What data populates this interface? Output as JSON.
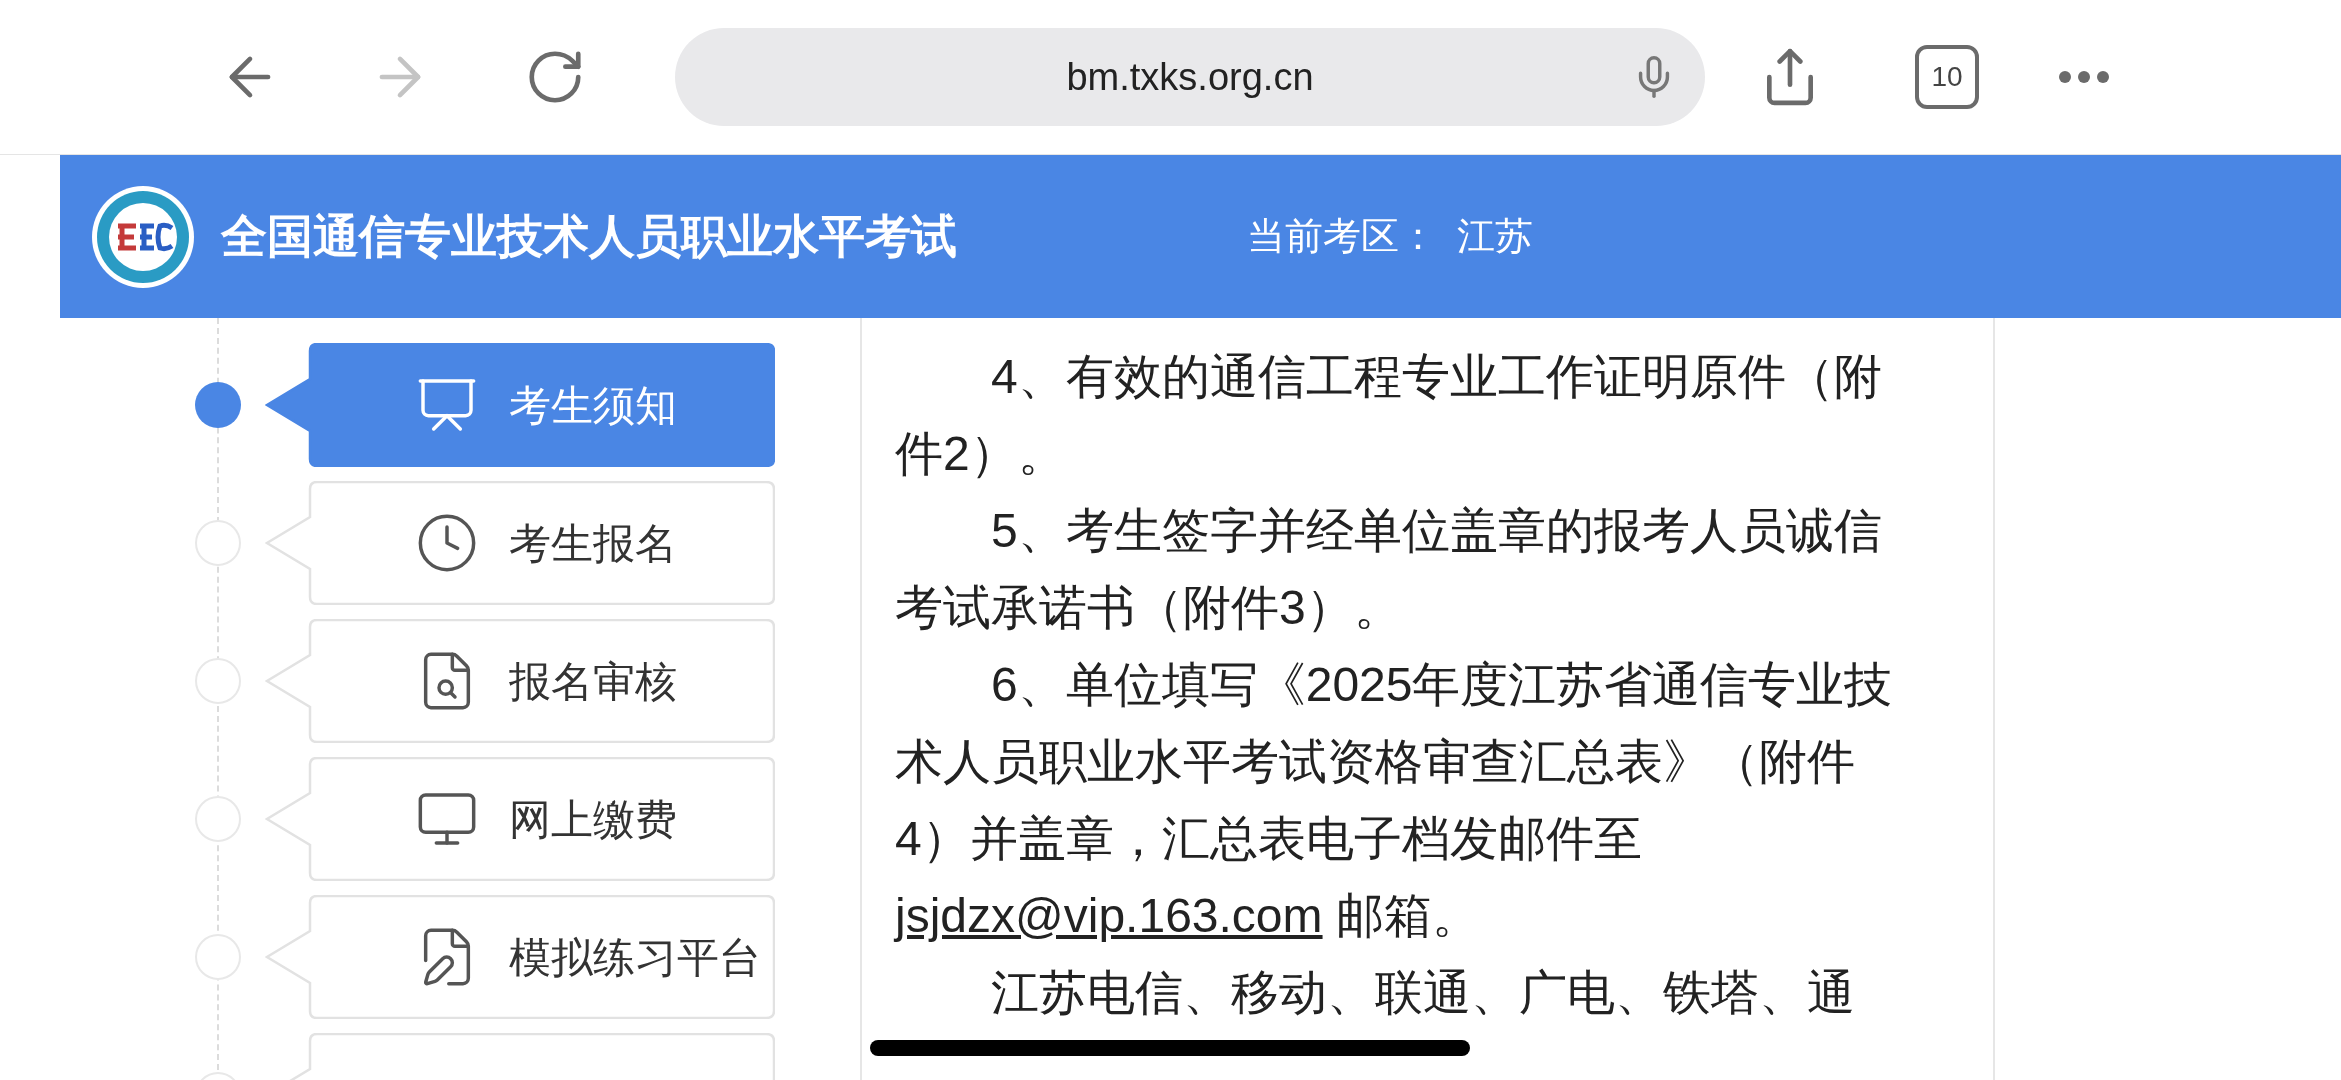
{
  "browser": {
    "url": "bm.txks.org.cn",
    "tab_count": "10",
    "forward_disabled": true
  },
  "header": {
    "title": "全国通信专业技术人员职业水平考试",
    "region_label": "当前考区：",
    "region": "江苏"
  },
  "sidebar": {
    "items": [
      {
        "label": "考生须知",
        "selected": true
      },
      {
        "label": "考生报名",
        "selected": false
      },
      {
        "label": "报名审核",
        "selected": false
      },
      {
        "label": "网上缴费",
        "selected": false
      },
      {
        "label": "模拟练习平台",
        "selected": false
      },
      {
        "selected": false
      }
    ]
  },
  "content": {
    "paragraphs": [
      {
        "text": "4、有效的通信工程专业工作证明原件（附件2）。"
      },
      {
        "text": "5、考生签字并经单位盖章的报考人员诚信考试承诺书（附件3）。"
      },
      {
        "text": "6、单位填写《2025年度江苏省通信专业技术人员职业水平考试资格审查汇总表》（附件4）并盖章，汇总表电子档发邮件至",
        "link": "jsjdzx@vip.163.com",
        "text_after": " 邮箱。"
      },
      {
        "text": "江苏电信、移动、联通、广电、铁塔、通"
      }
    ]
  }
}
